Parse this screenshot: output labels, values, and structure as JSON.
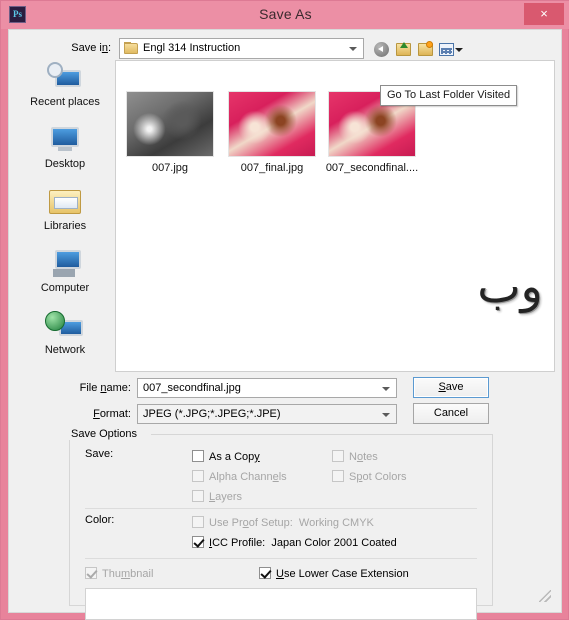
{
  "window": {
    "title": "Save As",
    "app_icon": "photoshop-icon",
    "app_icon_text": "Ps",
    "close_label": "×",
    "frame_color": "#eb8fa4",
    "close_button_color": "#d9596f"
  },
  "toolbar": {
    "save_in_label": "Save in:",
    "save_in_value": "Engl 314 Instruction",
    "buttons": [
      {
        "name": "back-button",
        "icon": "back-arrow-icon"
      },
      {
        "name": "up-folder-button",
        "icon": "up-folder-icon"
      },
      {
        "name": "new-folder-button",
        "icon": "new-folder-icon"
      },
      {
        "name": "view-menu-button",
        "icon": "view-grid-icon"
      }
    ],
    "tooltip": "Go To Last Folder Visited"
  },
  "places": [
    {
      "label": "Recent places",
      "icon": "recent-places-icon"
    },
    {
      "label": "Desktop",
      "icon": "desktop-icon"
    },
    {
      "label": "Libraries",
      "icon": "libraries-icon"
    },
    {
      "label": "Computer",
      "icon": "computer-icon"
    },
    {
      "label": "Network",
      "icon": "network-icon"
    }
  ],
  "files": [
    {
      "name": "007.jpg",
      "thumb": "grayscale-photo"
    },
    {
      "name": "007_final.jpg",
      "thumb": "pink-photo"
    },
    {
      "name": "007_secondfinal....",
      "thumb": "pink-photo"
    }
  ],
  "watermark": "وب",
  "fields": {
    "file_name_label": "File name:",
    "file_name_value": "007_secondfinal.jpg",
    "format_label": "Format:",
    "format_value": "JPEG (*.JPG;*.JPEG;*.JPE)"
  },
  "buttons": {
    "save": "Save",
    "cancel": "Cancel"
  },
  "save_options": {
    "group_title": "Save Options",
    "save_row_label": "Save:",
    "color_row_label": "Color:",
    "checkboxes": {
      "as_a_copy": {
        "label": "As a Copy",
        "checked": false,
        "enabled": true
      },
      "alpha_channels": {
        "label": "Alpha Channels",
        "checked": false,
        "enabled": false
      },
      "layers": {
        "label": "Layers",
        "checked": false,
        "enabled": false
      },
      "notes": {
        "label": "Notes",
        "checked": false,
        "enabled": false
      },
      "spot_colors": {
        "label": "Spot Colors",
        "checked": false,
        "enabled": false
      },
      "use_proof_setup": {
        "label": "Use Proof Setup:  Working CMYK",
        "checked": false,
        "enabled": false
      },
      "icc_profile": {
        "label": "ICC Profile:  Japan Color 2001 Coated",
        "checked": true,
        "enabled": true
      },
      "thumbnail": {
        "label": "Thumbnail",
        "checked": true,
        "enabled": false
      },
      "use_lower_case_extension": {
        "label": "Use Lower Case Extension",
        "checked": true,
        "enabled": true
      }
    }
  }
}
